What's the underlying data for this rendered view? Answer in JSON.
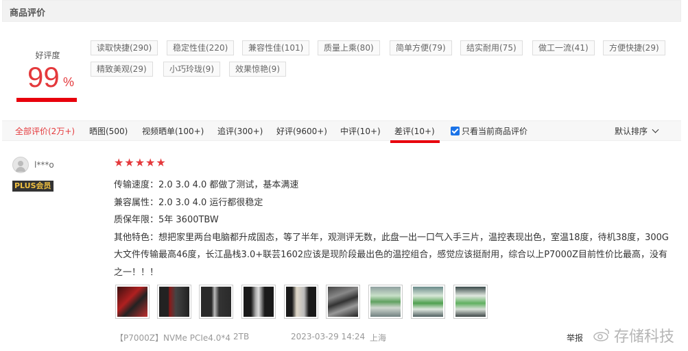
{
  "section": {
    "title": "商品评价"
  },
  "rating": {
    "label": "好评度",
    "value": "99",
    "unit": "%"
  },
  "tags": [
    "读取快捷(290)",
    "稳定性佳(220)",
    "兼容性佳(101)",
    "质量上乘(80)",
    "简单方便(79)",
    "结实耐用(75)",
    "做工一流(41)",
    "方便快捷(29)",
    "精致美观(29)",
    "小巧玲珑(9)",
    "效果惊艳(9)"
  ],
  "filters": [
    "全部评价(2万+)",
    "晒图(500)",
    "视频晒单(100+)",
    "追评(300+)",
    "好评(9600+)",
    "中评(10+)",
    "差评(10+)"
  ],
  "only_current": "只看当前商品评价",
  "sort": "默认排序",
  "review": {
    "user": "l***o",
    "badge": "PLUS会员",
    "stars": 5,
    "lines": [
      "传输速度：2.0 3.0 4.0 都做了测试，基本满速",
      "兼容属性：2.0 3.0 4.0 运行都很稳定",
      "质保年限：5年 3600TBW",
      "其他特色：想把家里两台电脑都升成固态，等了半年，观测评无数，此盘一出一口气入手三片，温控表现出色，室温18度，待机38度，300G大文件传输最高46度，长江晶栈3.0+联芸1602应该是现阶段最出色的温控组合，感觉应该挺耐用，综合以上P7000Z目前性价比最高，没有之一！！！"
    ],
    "product": "【P7000Z】NVMe PCIe4.0*4",
    "capacity": "2TB",
    "time": "2023-03-29 14:24",
    "location": "上海",
    "report": "举报"
  },
  "watermark": "存储科技"
}
